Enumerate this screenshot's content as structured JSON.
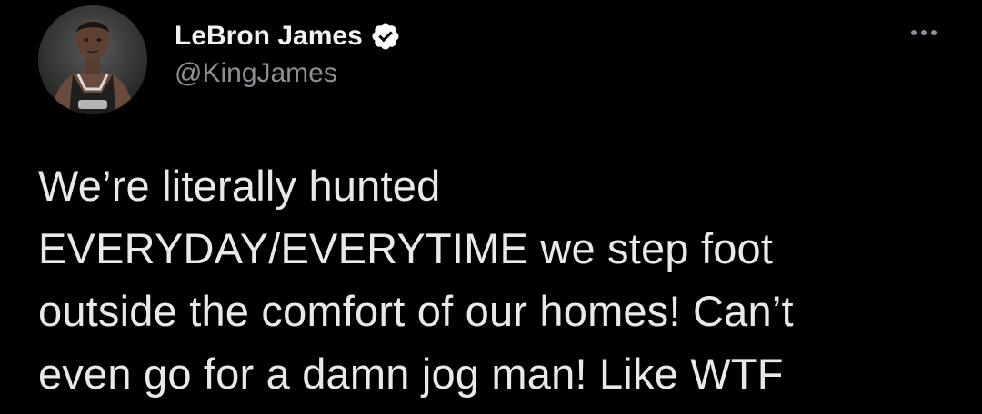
{
  "author": {
    "display_name": "LeBron James",
    "handle": "@KingJames",
    "verified": true,
    "avatar_icon": "profile-photo"
  },
  "menu": {
    "more_icon": "more-horizontal-icon"
  },
  "tweet": {
    "text": "We’re literally hunted\nEVERYDAY/EVERYTIME we step foot\noutside the comfort of our homes! Can’t\neven go for a damn jog man! Like WTF"
  },
  "colors": {
    "background": "#000000",
    "text": "#e7e9ea",
    "handle": "#8b9096",
    "verified_badge": "#ffffff"
  }
}
